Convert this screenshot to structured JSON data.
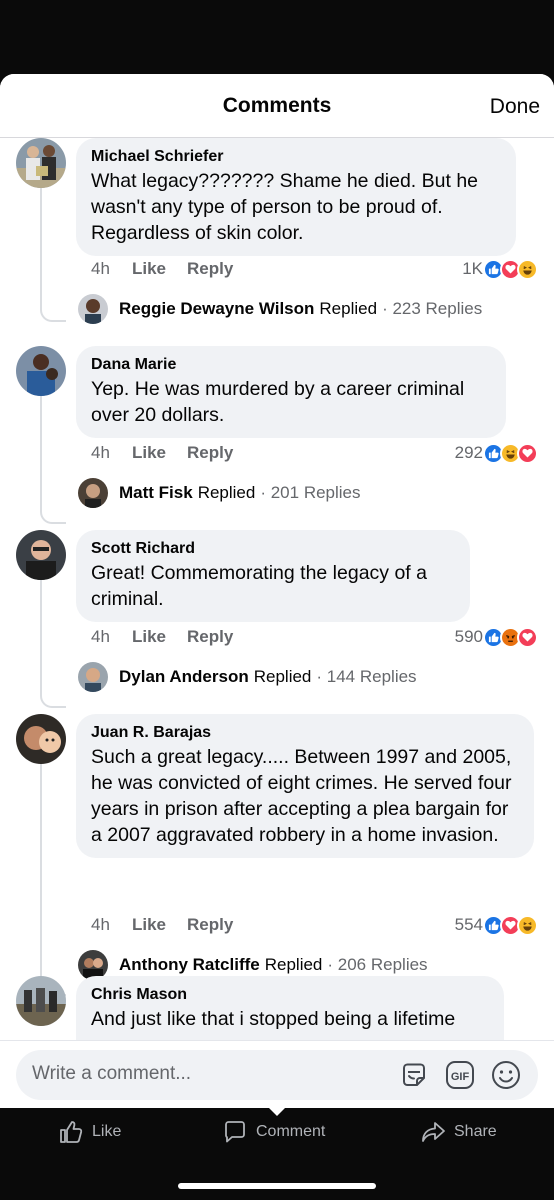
{
  "header": {
    "title": "Comments",
    "done_label": "Done"
  },
  "comments": [
    {
      "author": "Michael Schriefer",
      "text": "What legacy???????  Shame he died. But he wasn't any type of person to be proud of. Regardless of skin color.",
      "time": "4h",
      "like_label": "Like",
      "reply_label": "Reply",
      "reaction_count": "1K",
      "reactions": [
        "like-icon",
        "love-icon",
        "haha-icon"
      ],
      "reply": {
        "name": "Reggie Dewayne Wilson",
        "verb": "Replied",
        "count": "· 223 Replies"
      }
    },
    {
      "author": "Dana Marie",
      "text": "Yep. He was murdered by a career criminal over 20 dollars.",
      "time": "4h",
      "like_label": "Like",
      "reply_label": "Reply",
      "reaction_count": "292",
      "reactions": [
        "like-icon",
        "haha-icon",
        "love-icon"
      ],
      "reply": {
        "name": "Matt Fisk",
        "verb": "Replied",
        "count": "· 201 Replies"
      }
    },
    {
      "author": "Scott Richard",
      "text": "Great! Commemorating the legacy of a criminal.",
      "time": "4h",
      "like_label": "Like",
      "reply_label": "Reply",
      "reaction_count": "590",
      "reactions": [
        "like-icon",
        "angry-icon",
        "love-icon"
      ],
      "reply": {
        "name": "Dylan Anderson",
        "verb": "Replied",
        "count": "· 144 Replies"
      }
    },
    {
      "author": "Juan R. Barajas",
      "text": "Such a great legacy..... Between 1997 and 2005, he was convicted of eight crimes. He served four years in prison after accepting a plea bargain for a 2007 aggravated robbery in a home invasion.",
      "time": "4h",
      "like_label": "Like",
      "reply_label": "Reply",
      "reaction_count": "554",
      "reactions": [
        "like-icon",
        "love-icon",
        "haha-icon"
      ],
      "reply": {
        "name": "Anthony Ratcliffe",
        "verb": "Replied",
        "count": "· 206 Replies"
      }
    },
    {
      "author": "Chris Mason",
      "text": "And just like that i stopped being a lifetime"
    }
  ],
  "composer": {
    "placeholder": "Write a comment..."
  },
  "bottom_bar": {
    "like_label": "Like",
    "comment_label": "Comment",
    "share_label": "Share"
  },
  "colors": {
    "like": "#1b74e4",
    "love": "#f33e58",
    "haha": "#f7b928",
    "angry": "#e9710f",
    "bubble": "#f0f2f5"
  }
}
